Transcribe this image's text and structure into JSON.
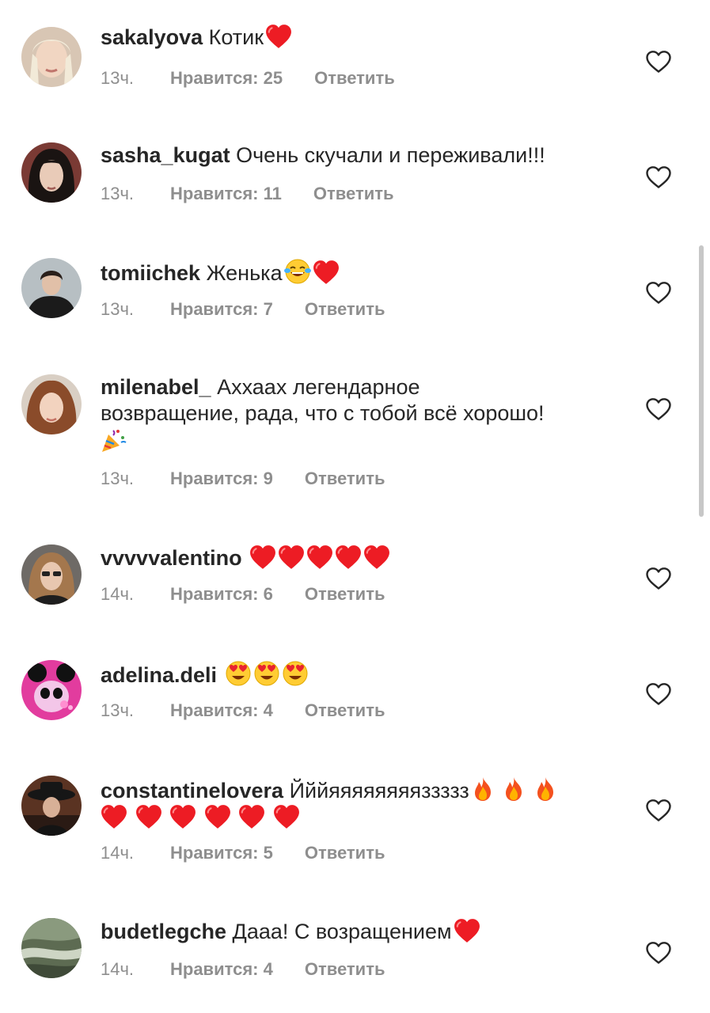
{
  "comments": [
    {
      "username": "sakalyova",
      "text": "Котик",
      "emojis": [
        "heart"
      ],
      "time": "13ч.",
      "likes": "Нравится: 25",
      "reply": "Ответить"
    },
    {
      "username": "sasha_kugat",
      "text": "Очень скучали и переживали!!!",
      "emojis": [],
      "time": "13ч.",
      "likes": "Нравится: 11",
      "reply": "Ответить"
    },
    {
      "username": "tomiichek",
      "text": "Женька",
      "emojis": [
        "tears-of-joy",
        "heart"
      ],
      "time": "13ч.",
      "likes": "Нравится: 7",
      "reply": "Ответить"
    },
    {
      "username": "milenabel_",
      "text_line1": "Аххаах легендарное",
      "text_line2": "возвращение, рада, что с тобой всё хорошо!",
      "emojis": [
        "party-popper"
      ],
      "time": "13ч.",
      "likes": "Нравится: 9",
      "reply": "Ответить"
    },
    {
      "username": "vvvvvalentino",
      "text": "",
      "emojis": [
        "heart",
        "heart",
        "heart",
        "heart",
        "heart"
      ],
      "time": "14ч.",
      "likes": "Нравится: 6",
      "reply": "Ответить"
    },
    {
      "username": "adelina.deli",
      "text": "",
      "emojis": [
        "heart-eyes",
        "heart-eyes",
        "heart-eyes"
      ],
      "time": "13ч.",
      "likes": "Нравится: 4",
      "reply": "Ответить"
    },
    {
      "username": "constantinelovera",
      "text": "Йййяяяяяяяяззззз",
      "emojis": [
        "fire",
        "fire",
        "fire",
        "heart",
        "heart",
        "heart",
        "heart",
        "heart",
        "heart"
      ],
      "time": "14ч.",
      "likes": "Нравится: 5",
      "reply": "Ответить"
    },
    {
      "username": "budetlegche",
      "text": "Дааа! С возращением",
      "emojis": [
        "heart"
      ],
      "time": "14ч.",
      "likes": "Нравится: 4",
      "reply": "Ответить"
    }
  ],
  "icons": {
    "like": "heart-outline-icon"
  },
  "colors": {
    "text": "#262626",
    "meta": "#8e8e8e",
    "heart": "#ed1c24",
    "scrollbar": "#c7c7c7"
  }
}
